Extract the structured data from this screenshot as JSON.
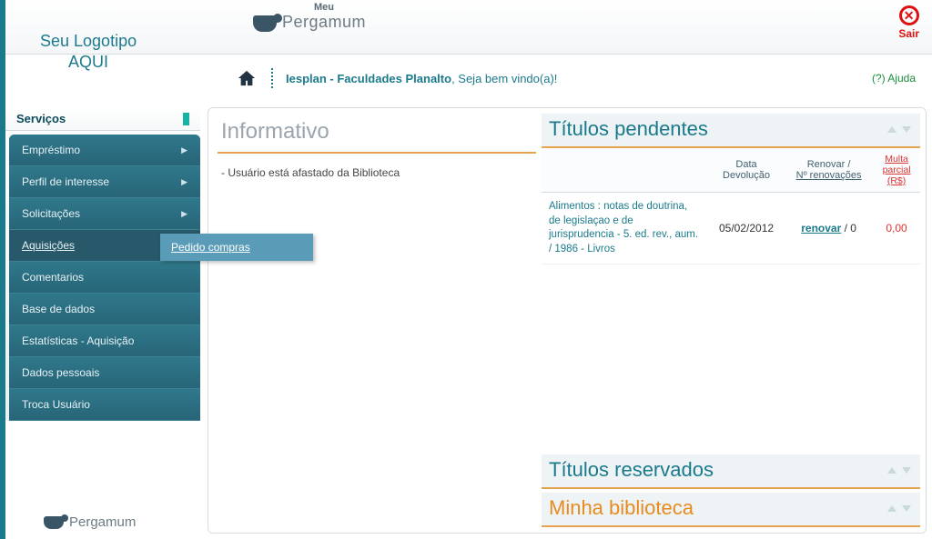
{
  "brand": {
    "meu": "Meu",
    "name": "Pergamum"
  },
  "exit_label": "Sair",
  "logo_placeholder_l1": "Seu Logotipo",
  "logo_placeholder_l2": "AQUI",
  "welcome": {
    "org": "Iesplan - Faculdades Planalto",
    "rest": " , Seja bem vindo(a)!"
  },
  "help": {
    "q": "(?)",
    "label": " Ajuda"
  },
  "sidebar": {
    "header": "Serviços",
    "items": [
      {
        "label": "Empréstimo",
        "has_sub": true
      },
      {
        "label": "Perfil de interesse",
        "has_sub": true
      },
      {
        "label": "Solicitações",
        "has_sub": true
      },
      {
        "label": "Aquisições",
        "has_sub": false,
        "active": true
      },
      {
        "label": "Comentarios",
        "has_sub": false
      },
      {
        "label": "Base de dados",
        "has_sub": false
      },
      {
        "label": "Estatísticas - Aquisição",
        "has_sub": false
      },
      {
        "label": "Dados pessoais",
        "has_sub": false
      },
      {
        "label": "Troca Usuário",
        "has_sub": false
      }
    ],
    "submenu_label": "Pedido compras"
  },
  "footer_brand": "Pergamum",
  "info": {
    "title": "Informativo",
    "body": "- Usuário está  afastado da Biblioteca"
  },
  "pending": {
    "title": "Títulos pendentes",
    "cols": {
      "title": "",
      "date_l1": "Data",
      "date_l2": "Devolução",
      "renew_l1": "Renovar /",
      "renew_l2": "Nº renovações",
      "fine_l1": "Multa",
      "fine_l2": "parcial",
      "fine_l3": "(R$)"
    },
    "row": {
      "title": "Alimentos : notas de doutrina, de legislaçao e de jurisprudencia - 5. ed. rev., aum. / 1986 - Livros",
      "date": "05/02/2012",
      "renew_link": "renovar",
      "sep": " / ",
      "renew_count": "0",
      "fine": "0,00"
    }
  },
  "reserved_title": "Títulos reservados",
  "mylib_title": "Minha biblioteca"
}
